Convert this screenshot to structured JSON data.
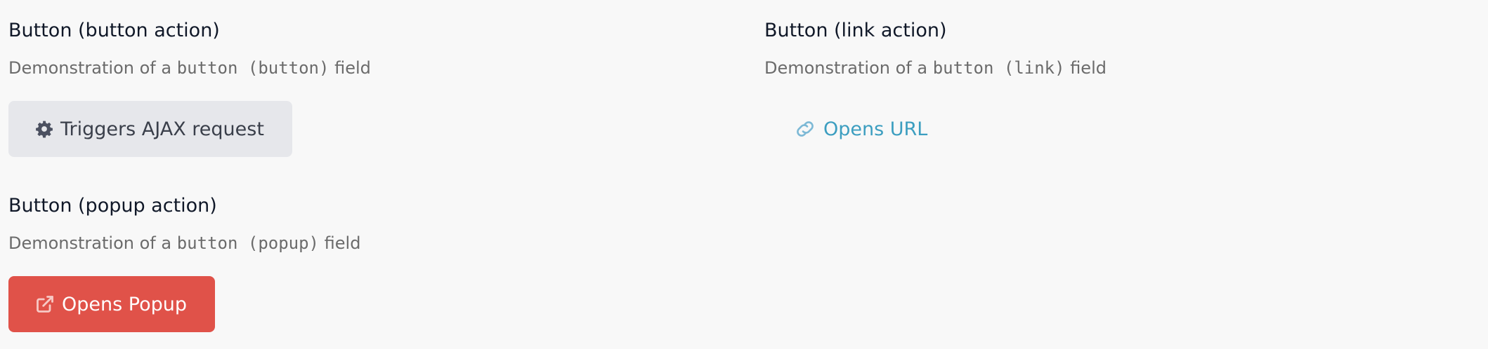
{
  "fields": {
    "button": {
      "title": "Button (button action)",
      "desc_prefix": "Demonstration of a ",
      "desc_code": "button (button)",
      "desc_suffix": " field",
      "button_label": "Triggers AJAX request",
      "icon": "gear-icon"
    },
    "link": {
      "title": "Button (link action)",
      "desc_prefix": "Demonstration of a ",
      "desc_code": "button (link)",
      "desc_suffix": " field",
      "button_label": "Opens URL",
      "icon": "link-icon"
    },
    "popup": {
      "title": "Button (popup action)",
      "desc_prefix": "Demonstration of a ",
      "desc_code": "button (popup)",
      "desc_suffix": " field",
      "button_label": "Opens Popup",
      "icon": "external-link-icon"
    }
  },
  "colors": {
    "background": "#f8f8f8",
    "ajax_button_bg": "#e6e7eb",
    "link_color": "#3c9ec0",
    "popup_button_bg": "#e05249"
  }
}
